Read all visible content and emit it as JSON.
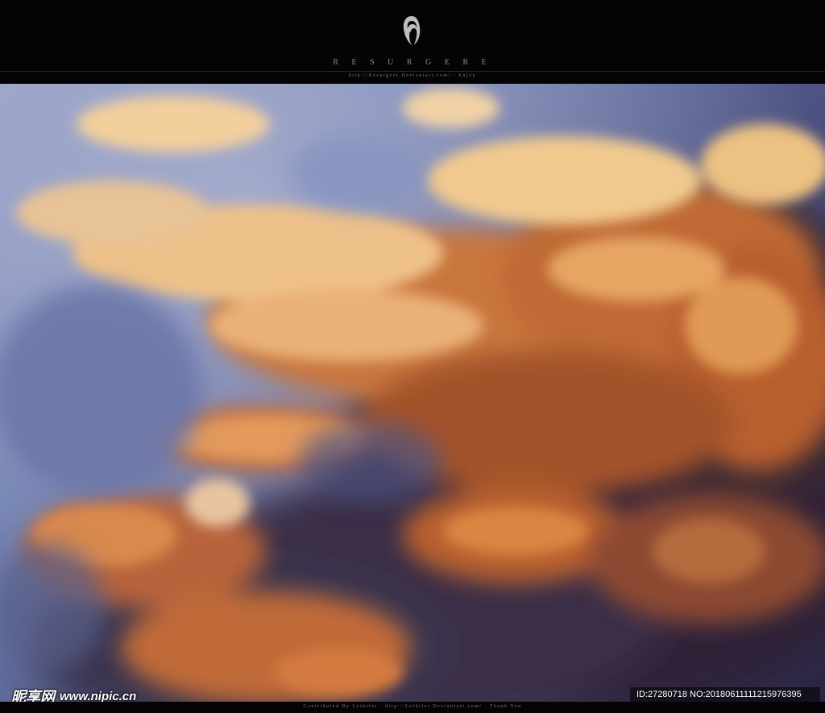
{
  "header": {
    "title": "R E S U R G E R E",
    "subtitle": "http://Resurgere.Deviantart.com/ · Enjoy",
    "logo_icon": "hooded-figure-logo-icon"
  },
  "footer": {
    "credit": "Contributed By Lethifer · http://Lethifer.Deviantart.com/ · Thank You"
  },
  "watermark": {
    "site_name": "昵享网",
    "site_url": "www.nipic.cn",
    "id_text": "ID:27280718 NO:20180611111215976395"
  },
  "colors": {
    "band": "#040404",
    "sky": "#6f7fb0",
    "cloud_light": "#f2c58a",
    "cloud_orange": "#d97a38",
    "cloud_dark": "#3b2a3c"
  }
}
